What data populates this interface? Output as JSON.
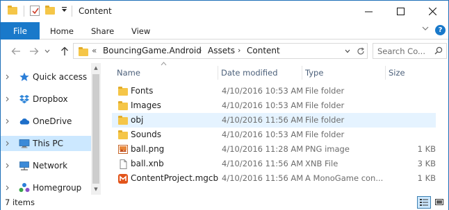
{
  "window": {
    "title": "Content"
  },
  "titlebar": {
    "quick_access_icons": [
      "folder-icon",
      "properties-check-icon",
      "new-folder-icon",
      "customize-dropdown-icon"
    ],
    "controls": {
      "minimize": "—",
      "maximize": "☐",
      "close": "✕"
    }
  },
  "ribbon": {
    "tabs": [
      {
        "label": "File"
      },
      {
        "label": "Home"
      },
      {
        "label": "Share"
      },
      {
        "label": "View"
      }
    ],
    "help": "?",
    "expand_glyph": "⌄"
  },
  "navigation": {
    "back_glyph": "←",
    "forward_glyph": "→",
    "recent_glyph": "⌄",
    "up_glyph": "↑",
    "overflow": "«",
    "breadcrumbs": [
      "BouncingGame.Android",
      "Assets",
      "Content"
    ],
    "search_placeholder": "Search Co...",
    "refresh_glyph": "↻"
  },
  "sidebar": {
    "items": [
      {
        "label": "Quick access",
        "icon": "star-icon",
        "expand": "›"
      },
      {
        "label": "Dropbox",
        "icon": "dropbox-icon",
        "expand": "›"
      },
      {
        "label": "OneDrive",
        "icon": "cloud-icon",
        "expand": "›"
      },
      {
        "label": "This PC",
        "icon": "computer-icon",
        "expand": "›",
        "selected": true
      },
      {
        "label": "Network",
        "icon": "network-icon",
        "expand": "›"
      },
      {
        "label": "Homegroup",
        "icon": "homegroup-icon",
        "expand": "›"
      }
    ]
  },
  "file_list": {
    "columns": [
      "Name",
      "Date modified",
      "Type",
      "Size"
    ],
    "rows": [
      {
        "name": "Fonts",
        "date": "4/10/2016 10:53 AM",
        "type": "File folder",
        "size": "",
        "icon": "folder-icon"
      },
      {
        "name": "Images",
        "date": "4/10/2016 10:53 AM",
        "type": "File folder",
        "size": "",
        "icon": "folder-icon"
      },
      {
        "name": "obj",
        "date": "4/10/2016 11:56 AM",
        "type": "File folder",
        "size": "",
        "icon": "folder-icon",
        "hovered": true
      },
      {
        "name": "Sounds",
        "date": "4/10/2016 10:53 AM",
        "type": "File folder",
        "size": "",
        "icon": "folder-icon"
      },
      {
        "name": "ball.png",
        "date": "4/10/2016 11:28 AM",
        "type": "PNG image",
        "size": "1 KB",
        "icon": "png-image-icon"
      },
      {
        "name": "ball.xnb",
        "date": "4/10/2016 11:56 AM",
        "type": "XNB File",
        "size": "3 KB",
        "icon": "generic-file-icon"
      },
      {
        "name": "ContentProject.mgcb",
        "date": "4/10/2016 11:56 AM",
        "type": "A MonoGame con...",
        "size": "1 KB",
        "icon": "monogame-icon"
      }
    ]
  },
  "status": {
    "item_count": "7 items",
    "views": [
      "details-view-icon",
      "large-icons-view-icon"
    ]
  },
  "colors": {
    "accent": "#1979ca",
    "folder": "#f5c648",
    "selected_nav": "#cce8ff",
    "hover_row": "#e5f3ff",
    "column_header": "#4c607a"
  }
}
